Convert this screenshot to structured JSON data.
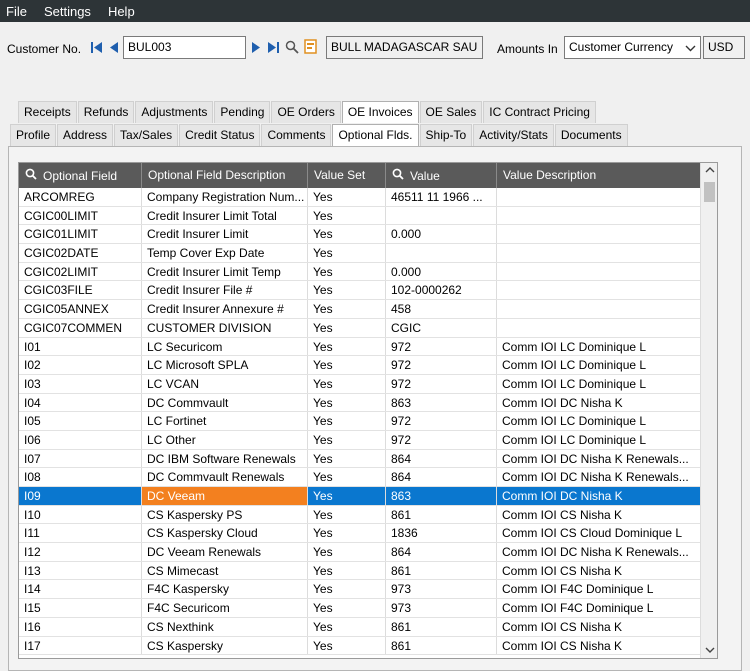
{
  "menu": {
    "file": "File",
    "settings": "Settings",
    "help": "Help"
  },
  "customer": {
    "label": "Customer No.",
    "number": "BUL003",
    "name": "BULL MADAGASCAR SAU",
    "amounts_label": "Amounts In",
    "amounts_value": "Customer Currency",
    "currency": "USD"
  },
  "tabs_top": [
    "Receipts",
    "Refunds",
    "Adjustments",
    "Pending",
    "OE Orders",
    "OE Invoices",
    "OE Sales",
    "IC Contract Pricing"
  ],
  "tabs_bottom": [
    "Profile",
    "Address",
    "Tax/Sales",
    "Credit Status",
    "Comments",
    "Optional Flds.",
    "Ship-To",
    "Activity/Stats",
    "Documents"
  ],
  "grid": {
    "headers": [
      "Optional Field",
      "Optional Field Description",
      "Value Set",
      "Value",
      "Value Description"
    ],
    "rows": [
      [
        "ARCOMREG",
        "Company Registration Num...",
        "Yes",
        "46511 11 1966 ...",
        ""
      ],
      [
        "CGIC00LIMIT",
        "Credit Insurer Limit Total",
        "Yes",
        "",
        ""
      ],
      [
        "CGIC01LIMIT",
        "Credit Insurer Limit",
        "Yes",
        "0.000",
        ""
      ],
      [
        "CGIC02DATE",
        "Temp Cover Exp Date",
        "Yes",
        "",
        ""
      ],
      [
        "CGIC02LIMIT",
        "Credit Insurer Limit Temp",
        "Yes",
        "0.000",
        ""
      ],
      [
        "CGIC03FILE",
        "Credit Insurer File #",
        "Yes",
        "102-0000262",
        ""
      ],
      [
        "CGIC05ANNEX",
        "Credit Insurer Annexure #",
        "Yes",
        "458",
        ""
      ],
      [
        "CGIC07COMMEN",
        "CUSTOMER DIVISION",
        "Yes",
        "CGIC",
        ""
      ],
      [
        "I01",
        "LC Securicom",
        "Yes",
        "972",
        "Comm IOI LC Dominique L"
      ],
      [
        "I02",
        "LC Microsoft SPLA",
        "Yes",
        "972",
        "Comm IOI LC Dominique L"
      ],
      [
        "I03",
        "LC VCAN",
        "Yes",
        "972",
        "Comm IOI LC Dominique L"
      ],
      [
        "I04",
        "DC Commvault",
        "Yes",
        "863",
        "Comm IOI DC Nisha K"
      ],
      [
        "I05",
        "LC Fortinet",
        "Yes",
        "972",
        "Comm IOI LC Dominique L"
      ],
      [
        "I06",
        "LC Other",
        "Yes",
        "972",
        "Comm IOI LC Dominique L"
      ],
      [
        "I07",
        "DC IBM Software Renewals",
        "Yes",
        "864",
        "Comm IOI DC Nisha K Renewals..."
      ],
      [
        "I08",
        "DC Commvault Renewals",
        "Yes",
        "864",
        "Comm IOI DC Nisha K Renewals..."
      ],
      [
        "I09",
        "DC Veeam",
        "Yes",
        "863",
        "Comm IOI DC Nisha K"
      ],
      [
        "I10",
        "CS Kaspersky PS",
        "Yes",
        "861",
        "Comm IOI CS Nisha K"
      ],
      [
        "I11",
        "CS Kaspersky Cloud",
        "Yes",
        "1836",
        "Comm IOI CS Cloud Dominique L"
      ],
      [
        "I12",
        "DC Veeam Renewals",
        "Yes",
        "864",
        "Comm IOI DC Nisha K Renewals..."
      ],
      [
        "I13",
        "CS Mimecast",
        "Yes",
        "861",
        "Comm IOI CS Nisha K"
      ],
      [
        "I14",
        "F4C Kaspersky",
        "Yes",
        "973",
        "Comm IOI F4C Dominique L"
      ],
      [
        "I15",
        "F4C Securicom",
        "Yes",
        "973",
        "Comm IOI F4C Dominique L"
      ],
      [
        "I16",
        "CS Nexthink",
        "Yes",
        "861",
        "Comm IOI CS Nisha K"
      ],
      [
        "I17",
        "CS Kaspersky",
        "Yes",
        "861",
        "Comm IOI CS Nisha K"
      ]
    ],
    "selected_row": 16
  },
  "icons": {
    "first": "first-record-icon",
    "prev": "previous-record-icon",
    "next": "next-record-icon",
    "last": "last-record-icon",
    "finder": "magnifier-icon",
    "new": "new-document-icon",
    "dropdown": "chevron-down-icon"
  },
  "colors": {
    "menubar": "#2d3437",
    "selection": "#0a77cf",
    "highlight_cell": "#f3801f",
    "header": "#5a5a5a"
  }
}
